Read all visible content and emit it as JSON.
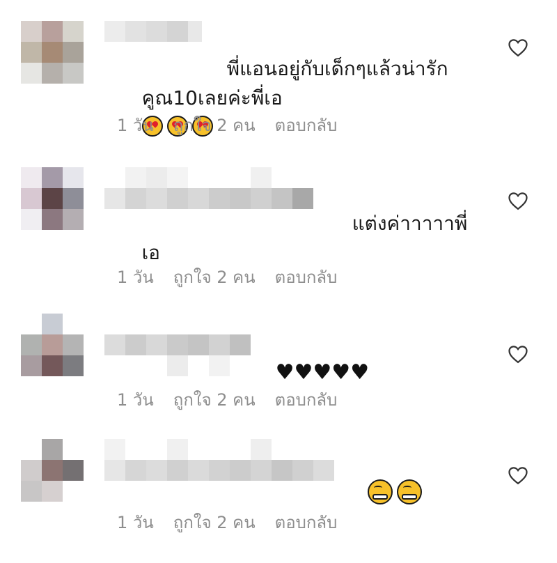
{
  "comments": [
    {
      "text_line1": "พี่แอนอยู่กับเด็กๆแล้วน่ารัก",
      "text_line2": "คูณ10เลยค่ะพี่เอ",
      "emoji": "heart-eyes",
      "emoji_count": 3,
      "time": "1 วัน",
      "likes": "ถูกใจ 2 คน",
      "reply": "ตอบกลับ"
    },
    {
      "text_line1": "แต่งค่าาาาาพี่",
      "text_line2": "เอ",
      "time": "1 วัน",
      "likes": "ถูกใจ 2 คน",
      "reply": "ตอบกลับ"
    },
    {
      "text_line1": "♥♥♥♥♥",
      "time": "1 วัน",
      "likes": "ถูกใจ 2 คน",
      "reply": "ตอบกลับ"
    },
    {
      "emoji": "grin",
      "emoji_count": 2,
      "time": "1 วัน",
      "likes": "ถูกใจ 2 คน",
      "reply": "ตอบกลับ"
    }
  ],
  "icons": {
    "like": "heart-outline-icon"
  },
  "colors": {
    "meta_text": "#8e8e8e",
    "body_text": "#1a1a1a"
  }
}
